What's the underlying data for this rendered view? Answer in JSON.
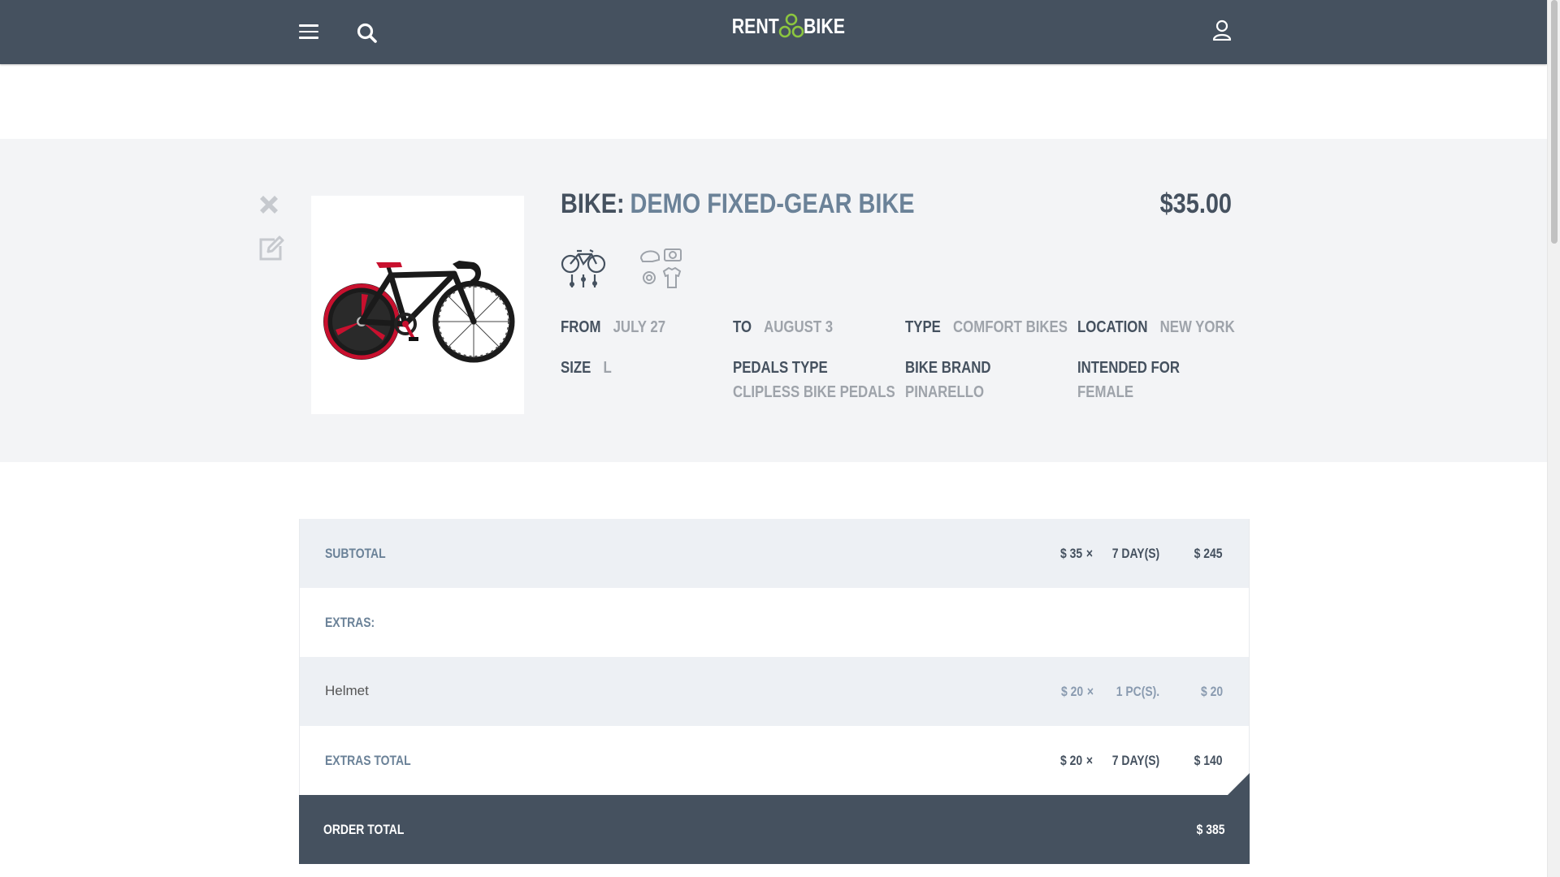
{
  "header": {
    "logo_left": "RENT",
    "logo_right": "BIKE",
    "icons": [
      "menu-icon",
      "search-icon",
      "user-icon"
    ]
  },
  "product": {
    "title_prefix": "BIKE:",
    "title_name": "DEMO FIXED-GEAR BIKE",
    "price": "$35.00",
    "feature_icons": [
      "bike-settings-icon",
      "accessories-icon"
    ],
    "attributes": {
      "from": {
        "label": "FROM",
        "value": "JULY 27"
      },
      "to": {
        "label": "TO",
        "value": "AUGUST 3"
      },
      "type": {
        "label": "TYPE",
        "value": "COMFORT BIKES"
      },
      "location": {
        "label": "LOCATION",
        "value": "NEW YORK"
      },
      "size": {
        "label": "SIZE",
        "value": "L"
      },
      "pedals": {
        "label": "PEDALS TYPE",
        "value": "CLIPLESS BIKE PEDALS"
      },
      "brand": {
        "label": "BIKE BRAND",
        "value": "PINARELLO"
      },
      "intended": {
        "label": "INTENDED FOR",
        "value": "FEMALE"
      }
    }
  },
  "order": {
    "subtotal": {
      "label": "SUBTOTAL",
      "unit_price": "$ 35",
      "times": "×",
      "qty": "7 DAY(S)",
      "amount": "$ 245"
    },
    "extras_label": "EXTRAS:",
    "extras": [
      {
        "name": "Helmet",
        "unit_price": "$ 20",
        "times": "×",
        "qty": "1 PC(S).",
        "amount": "$ 20"
      }
    ],
    "extras_total": {
      "label": "EXTRAS TOTAL",
      "unit_price": "$ 20",
      "times": "×",
      "qty": "7 DAY(S)",
      "amount": "$ 140"
    },
    "order_total": {
      "label": "ORDER TOTAL",
      "amount": "$ 385"
    }
  },
  "colors": {
    "header_bg": "#45515f",
    "accent_title": "#6b8298",
    "band_bg": "#f3f4f6",
    "row_shade": "#edf0f4",
    "logo_green": "#8cc63f"
  }
}
